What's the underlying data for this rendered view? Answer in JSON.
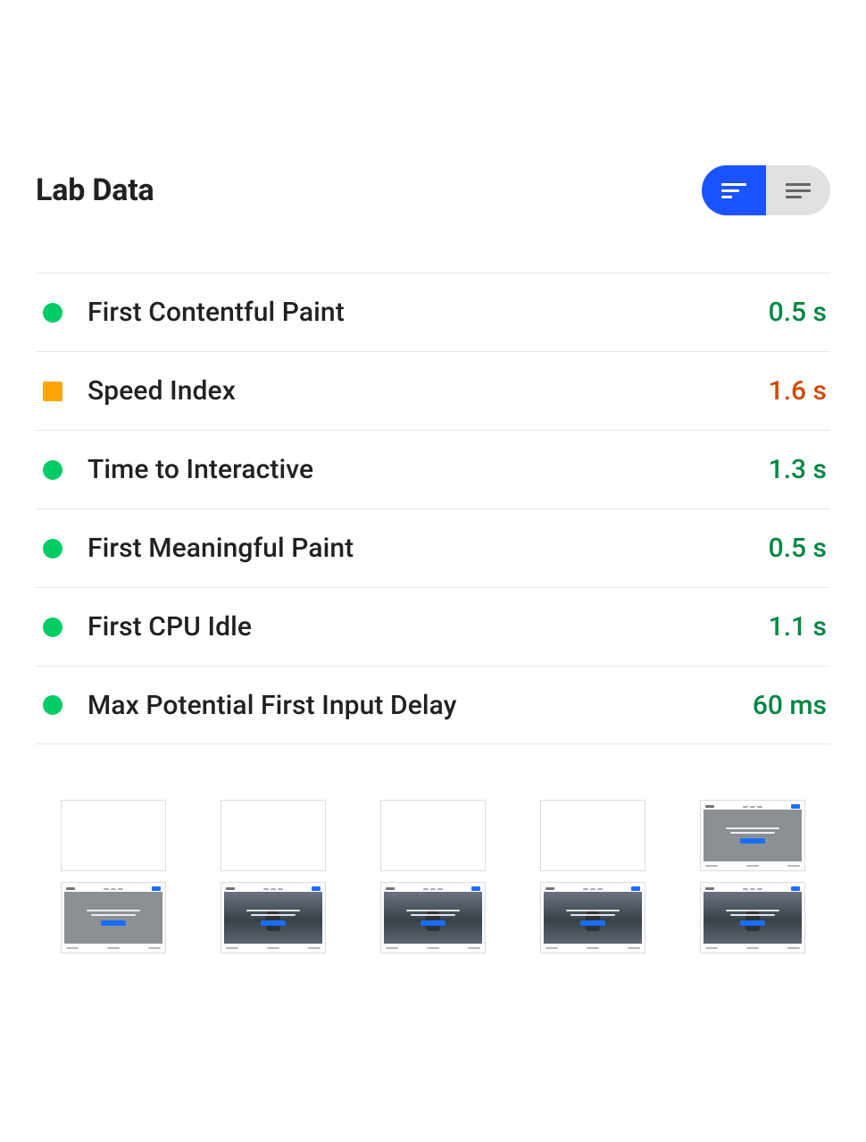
{
  "header": {
    "title": "Lab Data"
  },
  "metrics": [
    {
      "label": "First Contentful Paint",
      "value": "0.5 s",
      "status": "good",
      "valueColor": "green"
    },
    {
      "label": "Speed Index",
      "value": "1.6 s",
      "status": "average",
      "valueColor": "orange"
    },
    {
      "label": "Time to Interactive",
      "value": "1.3 s",
      "status": "good",
      "valueColor": "green"
    },
    {
      "label": "First Meaningful Paint",
      "value": "0.5 s",
      "status": "good",
      "valueColor": "green"
    },
    {
      "label": "First CPU Idle",
      "value": "1.1 s",
      "status": "good",
      "valueColor": "green"
    },
    {
      "label": "Max Potential First Input Delay",
      "value": "60 ms",
      "status": "good",
      "valueColor": "green"
    }
  ],
  "view": {
    "active": "compact"
  },
  "filmstrip": {
    "rows": [
      [
        {
          "state": "blank"
        },
        {
          "state": "blank"
        },
        {
          "state": "blank"
        },
        {
          "state": "blank"
        },
        {
          "state": "gray"
        }
      ],
      [
        {
          "state": "gray"
        },
        {
          "state": "photo"
        },
        {
          "state": "photo"
        },
        {
          "state": "photo"
        },
        {
          "state": "photo"
        }
      ]
    ]
  }
}
